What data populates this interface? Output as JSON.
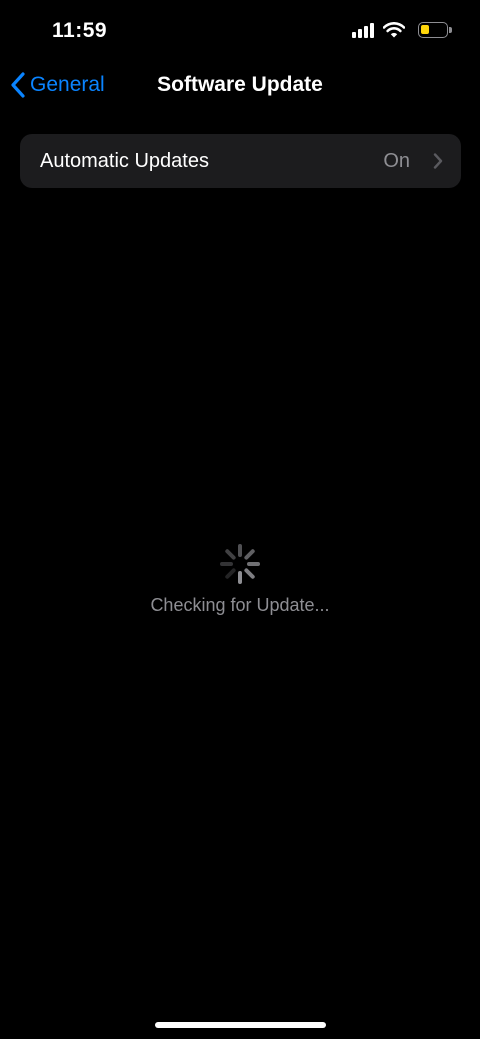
{
  "status_bar": {
    "time": "11:59",
    "battery_level": 0.35,
    "battery_color": "#ffd60a"
  },
  "nav": {
    "back_label": "General",
    "title": "Software Update",
    "accent_color": "#0a84ff"
  },
  "settings": {
    "automatic_updates": {
      "label": "Automatic Updates",
      "value": "On"
    }
  },
  "loading": {
    "text": "Checking for Update..."
  },
  "icons": {
    "back": "chevron-left-icon",
    "row": "chevron-right-icon",
    "spinner": "activity-spinner-icon",
    "signal": "cellular-signal-icon",
    "wifi": "wifi-icon",
    "battery": "battery-icon"
  }
}
